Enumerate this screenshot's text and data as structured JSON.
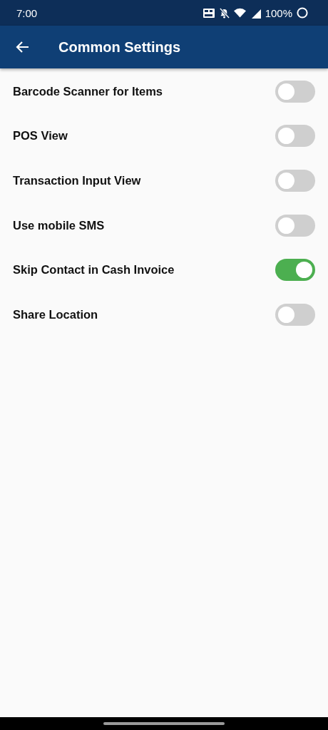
{
  "status_bar": {
    "time": "7:00",
    "battery": "100%"
  },
  "app_bar": {
    "title": "Common Settings"
  },
  "settings": [
    {
      "label": "Barcode Scanner for Items",
      "on": false
    },
    {
      "label": "POS View",
      "on": false
    },
    {
      "label": "Transaction Input View",
      "on": false
    },
    {
      "label": "Use mobile SMS",
      "on": false
    },
    {
      "label": "Skip Contact in Cash Invoice",
      "on": true
    },
    {
      "label": "Share Location",
      "on": false
    }
  ]
}
